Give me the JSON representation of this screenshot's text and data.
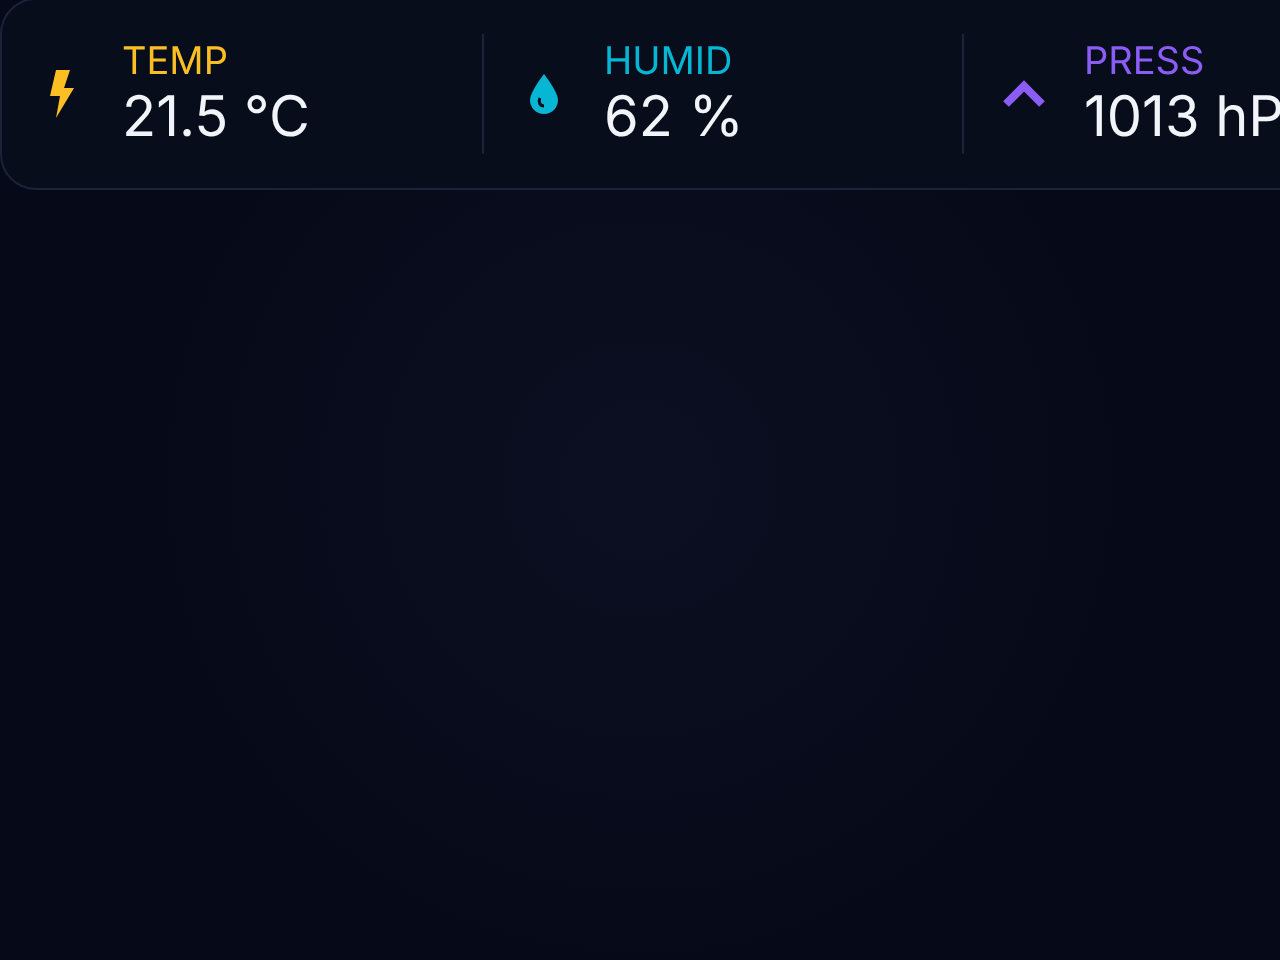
{
  "sensors": [
    {
      "kind": "bolt",
      "label": "TEMP",
      "value": "21.5 °C",
      "color": "#fbbf24"
    },
    {
      "kind": "drop",
      "label": "HUMID",
      "value": "62 %",
      "color": "#06b6d4"
    },
    {
      "kind": "chevron",
      "label": "PRESS",
      "value": "1013 hP",
      "color": "#8b5cf6"
    }
  ]
}
